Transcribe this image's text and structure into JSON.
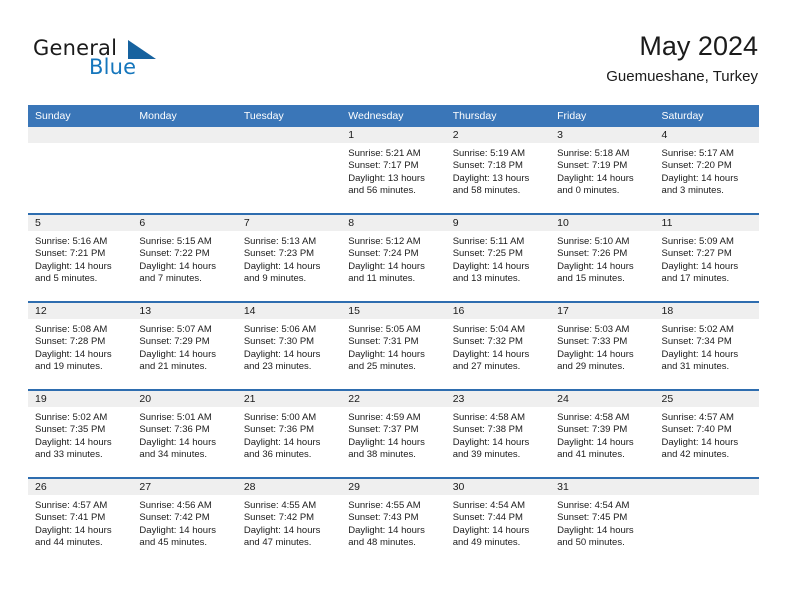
{
  "brand": {
    "name_part1": "General",
    "name_part2": "Blue",
    "accent_color": "#1576bc",
    "triangle_color": "#16629f"
  },
  "header": {
    "title": "May 2024",
    "subtitle": "Guemueshane, Turkey"
  },
  "calendar": {
    "header_bg": "#3a76b8",
    "row_rule_color": "#2e6daf",
    "daynum_band_bg": "#efefef",
    "weekdays": [
      "Sunday",
      "Monday",
      "Tuesday",
      "Wednesday",
      "Thursday",
      "Friday",
      "Saturday"
    ],
    "weeks": [
      [
        {
          "day": "",
          "sunrise": "",
          "sunset": "",
          "daylight_line1": "",
          "daylight_line2": ""
        },
        {
          "day": "",
          "sunrise": "",
          "sunset": "",
          "daylight_line1": "",
          "daylight_line2": ""
        },
        {
          "day": "",
          "sunrise": "",
          "sunset": "",
          "daylight_line1": "",
          "daylight_line2": ""
        },
        {
          "day": "1",
          "sunrise": "Sunrise: 5:21 AM",
          "sunset": "Sunset: 7:17 PM",
          "daylight_line1": "Daylight: 13 hours",
          "daylight_line2": "and 56 minutes."
        },
        {
          "day": "2",
          "sunrise": "Sunrise: 5:19 AM",
          "sunset": "Sunset: 7:18 PM",
          "daylight_line1": "Daylight: 13 hours",
          "daylight_line2": "and 58 minutes."
        },
        {
          "day": "3",
          "sunrise": "Sunrise: 5:18 AM",
          "sunset": "Sunset: 7:19 PM",
          "daylight_line1": "Daylight: 14 hours",
          "daylight_line2": "and 0 minutes."
        },
        {
          "day": "4",
          "sunrise": "Sunrise: 5:17 AM",
          "sunset": "Sunset: 7:20 PM",
          "daylight_line1": "Daylight: 14 hours",
          "daylight_line2": "and 3 minutes."
        }
      ],
      [
        {
          "day": "5",
          "sunrise": "Sunrise: 5:16 AM",
          "sunset": "Sunset: 7:21 PM",
          "daylight_line1": "Daylight: 14 hours",
          "daylight_line2": "and 5 minutes."
        },
        {
          "day": "6",
          "sunrise": "Sunrise: 5:15 AM",
          "sunset": "Sunset: 7:22 PM",
          "daylight_line1": "Daylight: 14 hours",
          "daylight_line2": "and 7 minutes."
        },
        {
          "day": "7",
          "sunrise": "Sunrise: 5:13 AM",
          "sunset": "Sunset: 7:23 PM",
          "daylight_line1": "Daylight: 14 hours",
          "daylight_line2": "and 9 minutes."
        },
        {
          "day": "8",
          "sunrise": "Sunrise: 5:12 AM",
          "sunset": "Sunset: 7:24 PM",
          "daylight_line1": "Daylight: 14 hours",
          "daylight_line2": "and 11 minutes."
        },
        {
          "day": "9",
          "sunrise": "Sunrise: 5:11 AM",
          "sunset": "Sunset: 7:25 PM",
          "daylight_line1": "Daylight: 14 hours",
          "daylight_line2": "and 13 minutes."
        },
        {
          "day": "10",
          "sunrise": "Sunrise: 5:10 AM",
          "sunset": "Sunset: 7:26 PM",
          "daylight_line1": "Daylight: 14 hours",
          "daylight_line2": "and 15 minutes."
        },
        {
          "day": "11",
          "sunrise": "Sunrise: 5:09 AM",
          "sunset": "Sunset: 7:27 PM",
          "daylight_line1": "Daylight: 14 hours",
          "daylight_line2": "and 17 minutes."
        }
      ],
      [
        {
          "day": "12",
          "sunrise": "Sunrise: 5:08 AM",
          "sunset": "Sunset: 7:28 PM",
          "daylight_line1": "Daylight: 14 hours",
          "daylight_line2": "and 19 minutes."
        },
        {
          "day": "13",
          "sunrise": "Sunrise: 5:07 AM",
          "sunset": "Sunset: 7:29 PM",
          "daylight_line1": "Daylight: 14 hours",
          "daylight_line2": "and 21 minutes."
        },
        {
          "day": "14",
          "sunrise": "Sunrise: 5:06 AM",
          "sunset": "Sunset: 7:30 PM",
          "daylight_line1": "Daylight: 14 hours",
          "daylight_line2": "and 23 minutes."
        },
        {
          "day": "15",
          "sunrise": "Sunrise: 5:05 AM",
          "sunset": "Sunset: 7:31 PM",
          "daylight_line1": "Daylight: 14 hours",
          "daylight_line2": "and 25 minutes."
        },
        {
          "day": "16",
          "sunrise": "Sunrise: 5:04 AM",
          "sunset": "Sunset: 7:32 PM",
          "daylight_line1": "Daylight: 14 hours",
          "daylight_line2": "and 27 minutes."
        },
        {
          "day": "17",
          "sunrise": "Sunrise: 5:03 AM",
          "sunset": "Sunset: 7:33 PM",
          "daylight_line1": "Daylight: 14 hours",
          "daylight_line2": "and 29 minutes."
        },
        {
          "day": "18",
          "sunrise": "Sunrise: 5:02 AM",
          "sunset": "Sunset: 7:34 PM",
          "daylight_line1": "Daylight: 14 hours",
          "daylight_line2": "and 31 minutes."
        }
      ],
      [
        {
          "day": "19",
          "sunrise": "Sunrise: 5:02 AM",
          "sunset": "Sunset: 7:35 PM",
          "daylight_line1": "Daylight: 14 hours",
          "daylight_line2": "and 33 minutes."
        },
        {
          "day": "20",
          "sunrise": "Sunrise: 5:01 AM",
          "sunset": "Sunset: 7:36 PM",
          "daylight_line1": "Daylight: 14 hours",
          "daylight_line2": "and 34 minutes."
        },
        {
          "day": "21",
          "sunrise": "Sunrise: 5:00 AM",
          "sunset": "Sunset: 7:36 PM",
          "daylight_line1": "Daylight: 14 hours",
          "daylight_line2": "and 36 minutes."
        },
        {
          "day": "22",
          "sunrise": "Sunrise: 4:59 AM",
          "sunset": "Sunset: 7:37 PM",
          "daylight_line1": "Daylight: 14 hours",
          "daylight_line2": "and 38 minutes."
        },
        {
          "day": "23",
          "sunrise": "Sunrise: 4:58 AM",
          "sunset": "Sunset: 7:38 PM",
          "daylight_line1": "Daylight: 14 hours",
          "daylight_line2": "and 39 minutes."
        },
        {
          "day": "24",
          "sunrise": "Sunrise: 4:58 AM",
          "sunset": "Sunset: 7:39 PM",
          "daylight_line1": "Daylight: 14 hours",
          "daylight_line2": "and 41 minutes."
        },
        {
          "day": "25",
          "sunrise": "Sunrise: 4:57 AM",
          "sunset": "Sunset: 7:40 PM",
          "daylight_line1": "Daylight: 14 hours",
          "daylight_line2": "and 42 minutes."
        }
      ],
      [
        {
          "day": "26",
          "sunrise": "Sunrise: 4:57 AM",
          "sunset": "Sunset: 7:41 PM",
          "daylight_line1": "Daylight: 14 hours",
          "daylight_line2": "and 44 minutes."
        },
        {
          "day": "27",
          "sunrise": "Sunrise: 4:56 AM",
          "sunset": "Sunset: 7:42 PM",
          "daylight_line1": "Daylight: 14 hours",
          "daylight_line2": "and 45 minutes."
        },
        {
          "day": "28",
          "sunrise": "Sunrise: 4:55 AM",
          "sunset": "Sunset: 7:42 PM",
          "daylight_line1": "Daylight: 14 hours",
          "daylight_line2": "and 47 minutes."
        },
        {
          "day": "29",
          "sunrise": "Sunrise: 4:55 AM",
          "sunset": "Sunset: 7:43 PM",
          "daylight_line1": "Daylight: 14 hours",
          "daylight_line2": "and 48 minutes."
        },
        {
          "day": "30",
          "sunrise": "Sunrise: 4:54 AM",
          "sunset": "Sunset: 7:44 PM",
          "daylight_line1": "Daylight: 14 hours",
          "daylight_line2": "and 49 minutes."
        },
        {
          "day": "31",
          "sunrise": "Sunrise: 4:54 AM",
          "sunset": "Sunset: 7:45 PM",
          "daylight_line1": "Daylight: 14 hours",
          "daylight_line2": "and 50 minutes."
        },
        {
          "day": "",
          "sunrise": "",
          "sunset": "",
          "daylight_line1": "",
          "daylight_line2": ""
        }
      ]
    ]
  }
}
